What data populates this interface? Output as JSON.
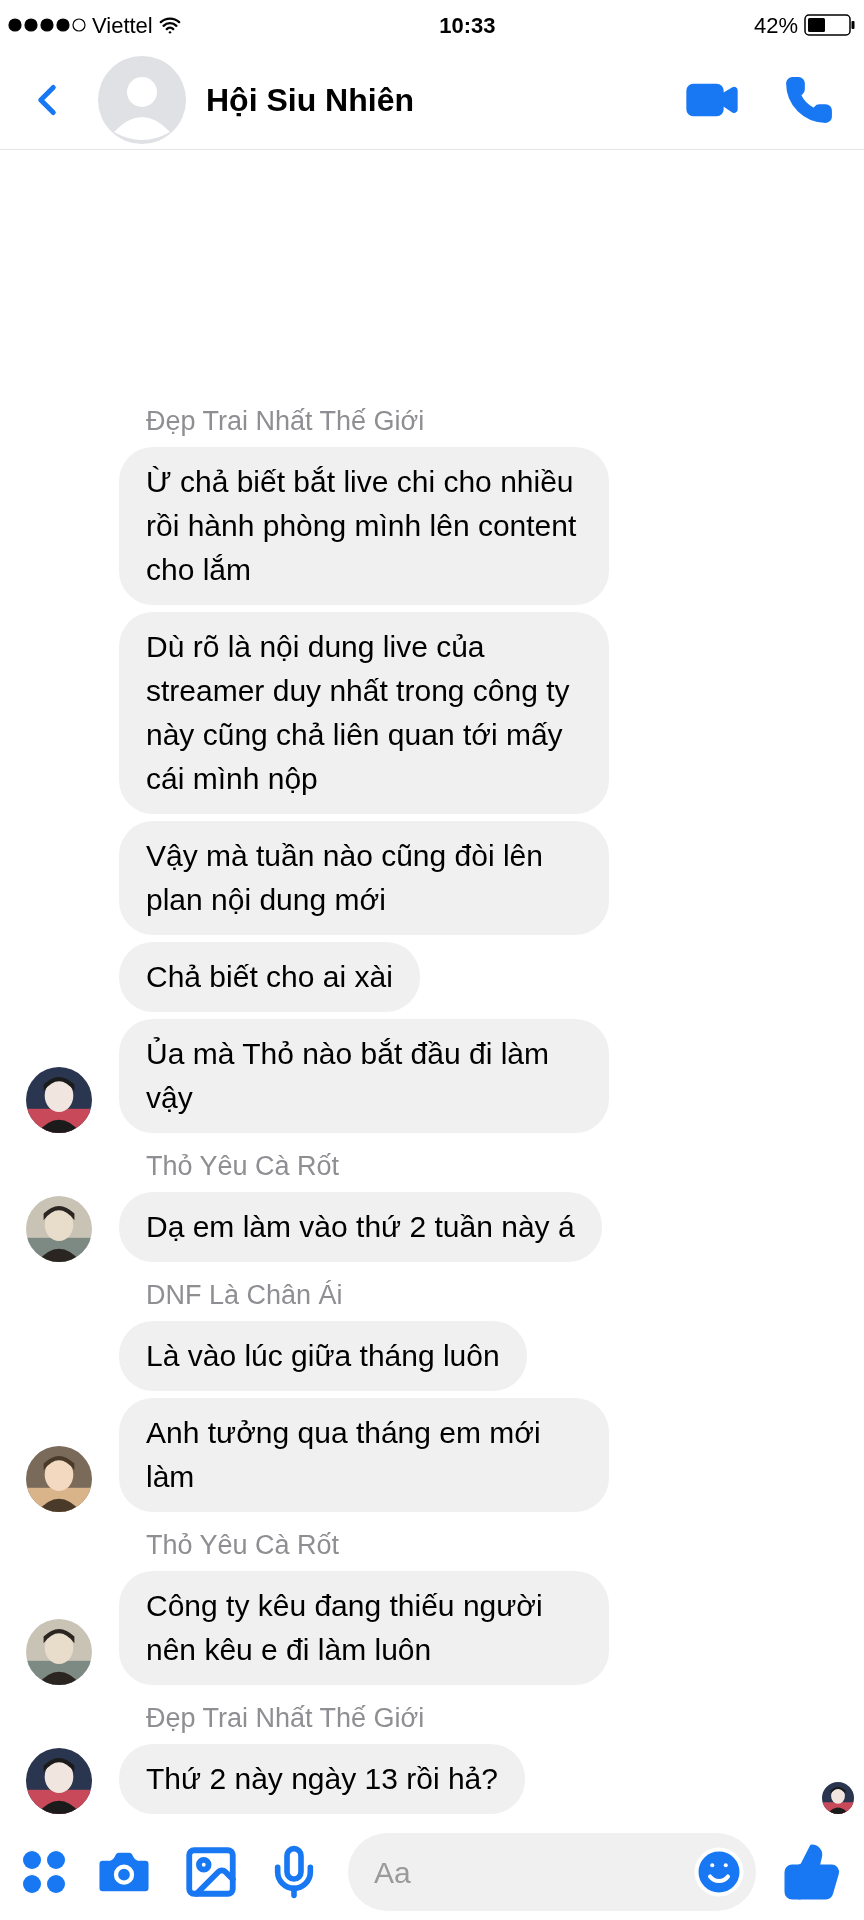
{
  "status_bar": {
    "carrier": "Viettel",
    "time": "10:33",
    "battery": "42%"
  },
  "header": {
    "title": "Hội Siu Nhiên"
  },
  "groups": [
    {
      "sender": "Đẹp Trai Nhất Thế Giới",
      "seen": false,
      "messages": [
        "Ừ chả biết bắt live chi cho nhiều rồi hành phòng mình lên content cho lắm",
        "Dù rõ là nội dung live của streamer duy nhất trong công ty này cũng chả liên quan tới mấy cái mình nộp",
        "Vậy mà tuần nào cũng đòi lên plan nội dung mới",
        "Chả biết cho ai xài",
        "Ủa mà Thỏ nào bắt đầu đi làm vậy"
      ]
    },
    {
      "sender": "Thỏ Yêu Cà Rốt",
      "seen": false,
      "messages": [
        "Dạ em làm vào thứ 2 tuần này á"
      ]
    },
    {
      "sender": "DNF Là Chân Ái",
      "seen": false,
      "messages": [
        "Là vào lúc giữa tháng luôn",
        "Anh tưởng qua tháng em mới làm"
      ]
    },
    {
      "sender": "Thỏ Yêu Cà Rốt",
      "seen": false,
      "messages": [
        "Công ty kêu đang thiếu người nên kêu e đi làm luôn"
      ]
    },
    {
      "sender": "Đẹp Trai Nhất Thế Giới",
      "seen": true,
      "messages": [
        "Thứ 2 này ngày 13 rồi hả?"
      ]
    }
  ],
  "composer": {
    "placeholder": "Aa"
  }
}
